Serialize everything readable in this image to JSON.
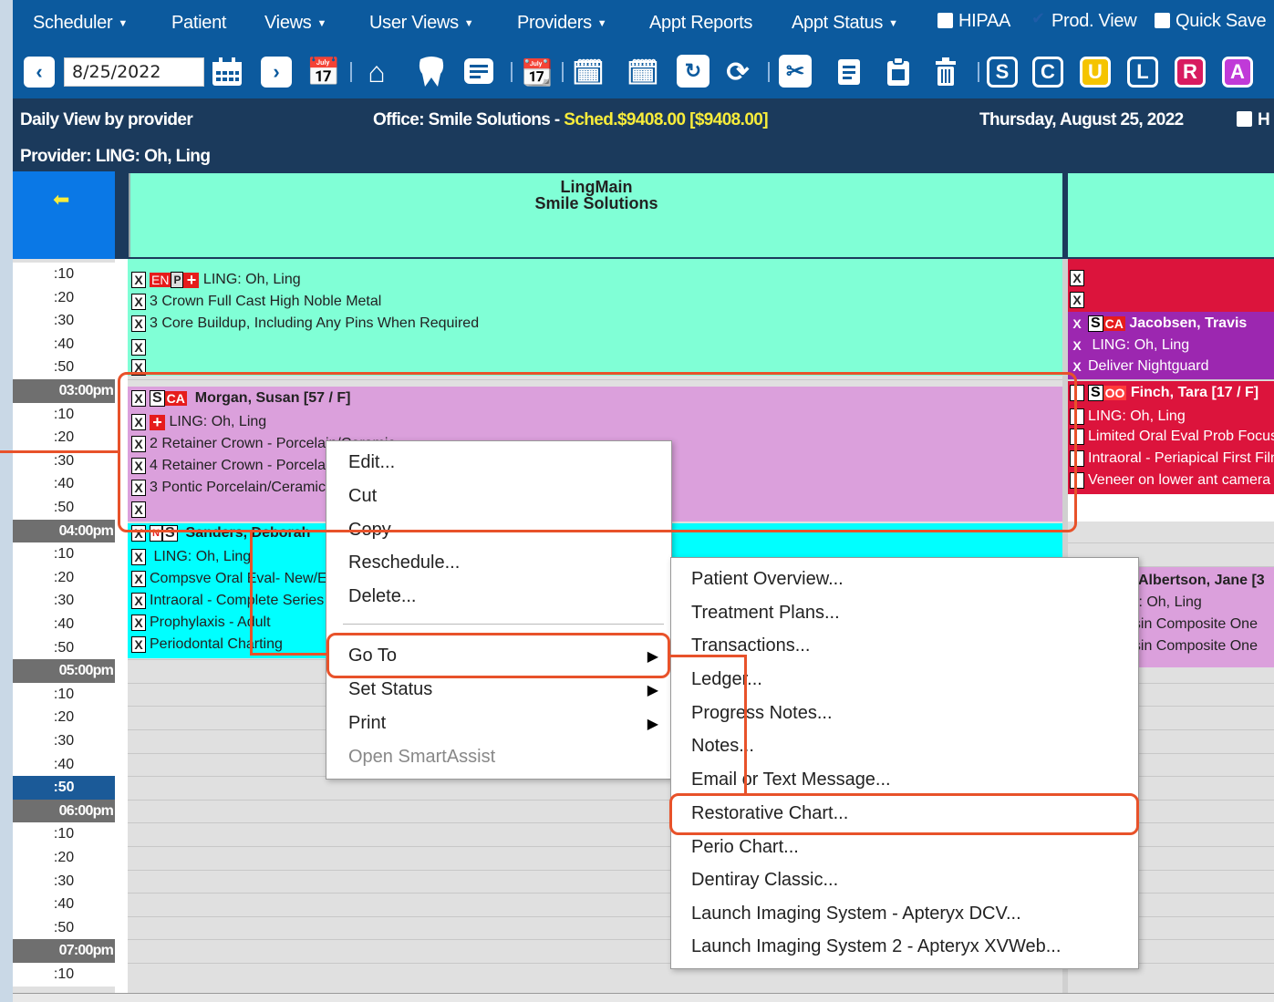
{
  "menu": {
    "scheduler": "Scheduler",
    "patient": "Patient",
    "views": "Views",
    "user_views": "User Views",
    "providers": "Providers",
    "appt_reports": "Appt Reports",
    "appt_status": "Appt Status",
    "hipaa": "HIPAA",
    "prod_view": "Prod. View",
    "quick_save": "Quick Save"
  },
  "toolbar": {
    "date": "8/25/2022",
    "letters": [
      "S",
      "C",
      "U",
      "L",
      "R",
      "A"
    ],
    "letter_colors": [
      "#0c5a9e",
      "#0c5a9e",
      "#f5c400",
      "#0c5a9e",
      "#d81b60",
      "#c03ad8"
    ]
  },
  "info": {
    "view": "Daily View by provider",
    "office": "Office: Smile Solutions - ",
    "sched": "Sched.$9408.00 [$9408.00]",
    "date": "Thursday, August 25, 2022",
    "provider": "Provider: LING: Oh, Ling",
    "trailing_label": "H"
  },
  "column": {
    "name": "LingMain",
    "office": "Smile Solutions"
  },
  "times": [
    ":10",
    ":20",
    ":30",
    ":40",
    ":50",
    "03:00pm",
    ":10",
    ":20",
    ":30",
    ":40",
    ":50",
    "04:00pm",
    ":10",
    ":20",
    ":30",
    ":40",
    ":50",
    "05:00pm",
    ":10",
    ":20",
    ":30",
    ":40",
    ":50",
    "06:00pm",
    ":10",
    ":20",
    ":30",
    ":40",
    ":50",
    "07:00pm",
    ":10"
  ],
  "appt1": {
    "tag": "EN",
    "provider": "LING: Oh, Ling",
    "line1": "3 Crown Full Cast High Noble Metal",
    "line2": "3 Core Buildup, Including Any Pins When Required"
  },
  "appt2": {
    "s": "S",
    "tag": "CA",
    "name": "Morgan, Susan [57 / F]",
    "provider": "LING: Oh, Ling",
    "line1": "2 Retainer Crown - Porcelain/Ceramic",
    "line2": "4 Retainer Crown - Porcelain/Ceramic",
    "line3": "3 Pontic Porcelain/Ceramic"
  },
  "appt3": {
    "s": "S",
    "name": "Sanders, Deborah",
    "provider": "LING: Oh, Ling",
    "line1": "Compsve Oral Eval- New/Established",
    "line2": "Intraoral - Complete Series",
    "line3": "Prophylaxis - Adult",
    "line4": "Periodontal Charting"
  },
  "right": {
    "jac_s": "S",
    "jac_tag": "CA",
    "jac_name": "Jacobsen, Travis",
    "jac_provider": "LING: Oh, Ling",
    "jac_line": "Deliver Nightguard",
    "fin_s": "S",
    "fin_tag": "OO",
    "fin_name": "Finch, Tara [17 / F]",
    "fin_provider": "LING: Oh, Ling",
    "fin_line1": "Limited Oral Eval Prob Focused",
    "fin_line2": "Intraoral - Periapical First Film",
    "fin_line3": "Veneer on lower ant camera",
    "alb_name": "Albertson, Jane [3",
    "alb_provider": "G: Oh, Ling",
    "alb_line1": "esin Composite One",
    "alb_line2": "esin Composite One"
  },
  "context_menu": {
    "edit": "Edit...",
    "cut": "Cut",
    "copy": "Copy",
    "reschedule": "Reschedule...",
    "delete": "Delete...",
    "goto": "Go To",
    "set_status": "Set Status",
    "print": "Print",
    "smartassist": "Open SmartAssist"
  },
  "submenu": {
    "overview": "Patient Overview...",
    "treatment": "Treatment Plans...",
    "transactions": "Transactions...",
    "ledger": "Ledger...",
    "progress": "Progress Notes...",
    "notes": "Notes...",
    "email": "Email or Text Message...",
    "restorative": "Restorative Chart...",
    "perio": "Perio Chart...",
    "dentiray": "Dentiray Classic...",
    "imaging1": "Launch Imaging System - Apteryx DCV...",
    "imaging2": "Launch Imaging System 2 - Apteryx XVWeb..."
  },
  "colors": {
    "mint": "#80ffd6",
    "orchid": "#dba0dc",
    "cyan": "#00ffff",
    "crimson": "#dc143c",
    "purple": "#9c27b0",
    "highlight": "#e8522a"
  }
}
